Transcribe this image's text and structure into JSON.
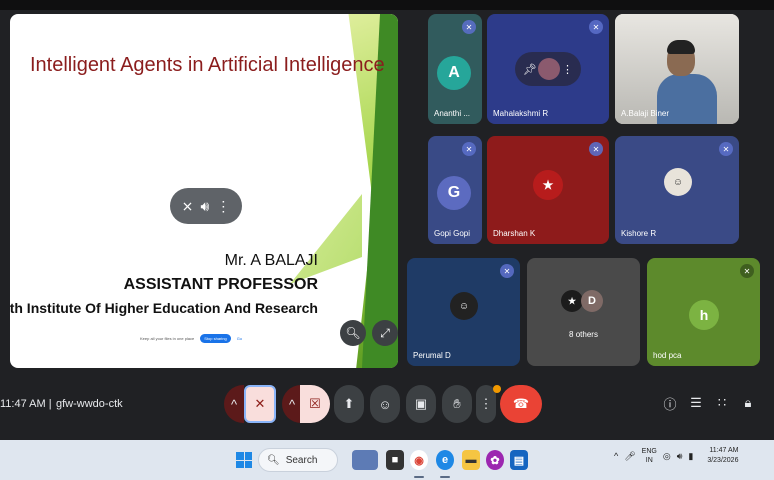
{
  "slide": {
    "title": "Intelligent Agents in Artificial Intelligence",
    "presenter_name": "Mr. A BALAJI",
    "presenter_role": "ASSISTANT PROFESSOR",
    "institution": "Bharath Institute Of Higher Education And Research",
    "banner_text": "Keep all your files in one place",
    "banner_button": "Stop sharing",
    "banner_link": "Go"
  },
  "participants": [
    {
      "name": "Ananthi ...",
      "initial": "A",
      "muted": true
    },
    {
      "name": "Mahalakshmi R",
      "muted": true
    },
    {
      "name": "A.Balaji Biner",
      "muted": false
    },
    {
      "name": "Gopi Gopi",
      "initial": "G",
      "muted": true
    },
    {
      "name": "Dharshan K",
      "muted": true
    },
    {
      "name": "Kishore R",
      "muted": true
    },
    {
      "name": "Perumal D",
      "muted": true
    },
    {
      "name": "8 others",
      "initial": "D"
    },
    {
      "name": "hod pca",
      "initial": "h",
      "muted": true
    }
  ],
  "meeting": {
    "time": "11:47 AM",
    "separator": "|",
    "code": "gfw-wwdo-ctk"
  },
  "controls": {
    "mic_icon": "mic-off-icon",
    "camera_icon": "camera-off-icon",
    "leave_color": "#ea4335",
    "accent_color": "#8ab4f8"
  },
  "taskbar": {
    "search_placeholder": "Search",
    "lang_top": "ENG",
    "lang_bottom": "IN",
    "clock_time": "11:47 AM",
    "clock_date": "3/23/2026"
  }
}
